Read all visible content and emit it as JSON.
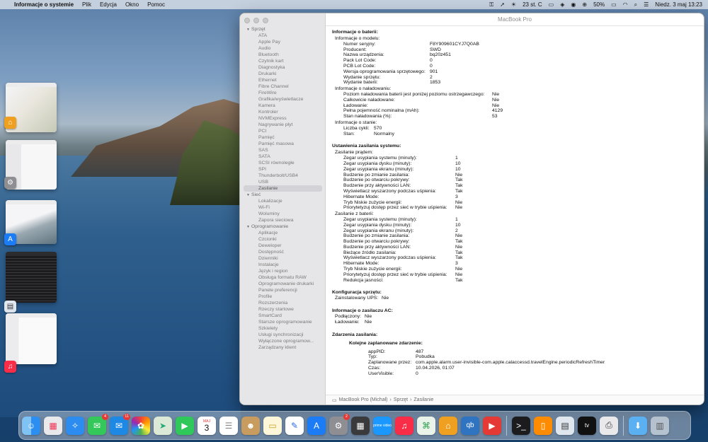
{
  "menubar": {
    "app_name": "Informacje o systemie",
    "menus": [
      "Plik",
      "Edycja",
      "Okno",
      "Pomoc"
    ],
    "weather": "23 st. C",
    "battery": "50%",
    "datetime": "Niedz. 3 maj  13:23"
  },
  "window": {
    "title": "MacBook Pro",
    "sidebar": [
      {
        "group": "Sprzęt",
        "items": [
          "ATA",
          "Apple Pay",
          "Audio",
          "Bluetooth",
          "Czytnik kart",
          "Diagnostyka",
          "Drukarki",
          "Ethernet",
          "Fibre Channel",
          "FireWire",
          "Grafika/wyświetlacze",
          "Kamera",
          "Kontroler",
          "NVMExpress",
          "Nagrywanie płyt",
          "PCI",
          "Pamięć",
          "Pamięć masowa",
          "SAS",
          "SATA",
          "SCSI równoległe",
          "SPI",
          "Thunderbolt/USB4",
          "USB",
          "Zasilanie"
        ]
      },
      {
        "group": "Sieć",
        "items": [
          "Lokalizacje",
          "Wi-Fi",
          "Woluminy",
          "Zapora sieciowa"
        ]
      },
      {
        "group": "Oprogramowanie",
        "items": [
          "Aplikacje",
          "Czcionki",
          "Deweloper",
          "Dostępność",
          "Dzienniki",
          "Instalacje",
          "Język i region",
          "Obsługa formatu RAW",
          "Oprogramowanie drukarki",
          "Panele preferencji",
          "Profile",
          "Rozszerzenia",
          "Rzeczy startowe",
          "SmartCard",
          "Starsze oprogramowanie",
          "Szkielety",
          "Usługi synchronizacji",
          "Wyłączone oprogramow...",
          "Zarządzany klient"
        ]
      }
    ],
    "selected_item": "Zasilanie",
    "detail": [
      {
        "type": "h",
        "text": "Informacje o baterii:"
      },
      {
        "type": "sub",
        "indent": 4,
        "text": "Informacje o modelu:"
      },
      {
        "type": "kv",
        "indent": 16,
        "kw": 122,
        "k": "Numer seryjny:",
        "v": "F8Y909601CYJ7Q0AB"
      },
      {
        "type": "kv",
        "indent": 16,
        "kw": 122,
        "k": "Producent:",
        "v": "SWD"
      },
      {
        "type": "kv",
        "indent": 16,
        "kw": 122,
        "k": "Nazwa urządzenia:",
        "v": "bq20z451"
      },
      {
        "type": "kv",
        "indent": 16,
        "kw": 122,
        "k": "Pack Lot Code:",
        "v": "0"
      },
      {
        "type": "kv",
        "indent": 16,
        "kw": 122,
        "k": "PCB Lot Code:",
        "v": "0"
      },
      {
        "type": "kv",
        "indent": 16,
        "kw": 122,
        "k": "Wersja oprogramowania sprzętowego:",
        "v": "901"
      },
      {
        "type": "kv",
        "indent": 16,
        "kw": 122,
        "k": "Wydanie sprzętu:",
        "v": "2"
      },
      {
        "type": "kv",
        "indent": 16,
        "kw": 122,
        "k": "Wydanie baterii:",
        "v": "1853"
      },
      {
        "type": "sub",
        "indent": 4,
        "text": "Informacje o naładowaniu:"
      },
      {
        "type": "kv",
        "indent": 16,
        "kw": 210,
        "k": "Poziom naładowania baterii jest poniżej poziomu ostrzegawczego:",
        "v": "Nie"
      },
      {
        "type": "kv",
        "indent": 16,
        "kw": 210,
        "k": "Całkowicie naładowane:",
        "v": "Nie"
      },
      {
        "type": "kv",
        "indent": 16,
        "kw": 210,
        "k": "Ładowanie:",
        "v": "Nie"
      },
      {
        "type": "kv",
        "indent": 16,
        "kw": 210,
        "k": "Pełna pojemność nominalna (mAh):",
        "v": "4129"
      },
      {
        "type": "kv",
        "indent": 16,
        "kw": 210,
        "k": "Stan naładowania (%):",
        "v": "53"
      },
      {
        "type": "sub",
        "indent": 4,
        "text": "Informacje o stanie:"
      },
      {
        "type": "kv",
        "indent": 16,
        "kw": 43,
        "k": "Liczba cykli:",
        "v": "570"
      },
      {
        "type": "kv",
        "indent": 16,
        "kw": 43,
        "k": "Stan:",
        "v": "Normalny"
      },
      {
        "type": "h",
        "text": "Ustawienia zasilania systemu:"
      },
      {
        "type": "sub",
        "indent": 4,
        "text": "Zasilanie prądem:"
      },
      {
        "type": "kv",
        "indent": 16,
        "kw": 158,
        "k": "Zegar usypiania systemu (minuty):",
        "v": "1"
      },
      {
        "type": "kv",
        "indent": 16,
        "kw": 158,
        "k": "Zegar usypiania dysku (minuty):",
        "v": "10"
      },
      {
        "type": "kv",
        "indent": 16,
        "kw": 158,
        "k": "Zegar usypiania ekranu (minuty):",
        "v": "10"
      },
      {
        "type": "kv",
        "indent": 16,
        "kw": 158,
        "k": "Budzenie po zmianie zasilania:",
        "v": "Nie"
      },
      {
        "type": "kv",
        "indent": 16,
        "kw": 158,
        "k": "Budzenie po otwarciu pokrywy:",
        "v": "Tak"
      },
      {
        "type": "kv",
        "indent": 16,
        "kw": 158,
        "k": "Budzenie przy aktywności LAN:",
        "v": "Tak"
      },
      {
        "type": "kv",
        "indent": 16,
        "kw": 158,
        "k": "Wyświetlacz wyszarzony podczas uśpienia:",
        "v": "Tak"
      },
      {
        "type": "kv",
        "indent": 16,
        "kw": 158,
        "k": "Hibernate Mode:",
        "v": "3"
      },
      {
        "type": "kv",
        "indent": 16,
        "kw": 158,
        "k": "Tryb Niskie zużycie energii:",
        "v": "Nie"
      },
      {
        "type": "kv",
        "indent": 16,
        "kw": 158,
        "k": "Priorytetyzuj dostęp przez sieć w trybie uśpienia:",
        "v": "Nie"
      },
      {
        "type": "sub",
        "indent": 4,
        "text": "Zasilanie z baterii:"
      },
      {
        "type": "kv",
        "indent": 16,
        "kw": 158,
        "k": "Zegar usypiania systemu (minuty):",
        "v": "1"
      },
      {
        "type": "kv",
        "indent": 16,
        "kw": 158,
        "k": "Zegar usypiania dysku (minuty):",
        "v": "10"
      },
      {
        "type": "kv",
        "indent": 16,
        "kw": 158,
        "k": "Zegar usypiania ekranu (minuty):",
        "v": "2"
      },
      {
        "type": "kv",
        "indent": 16,
        "kw": 158,
        "k": "Budzenie po zmianie zasilania:",
        "v": "Nie"
      },
      {
        "type": "kv",
        "indent": 16,
        "kw": 158,
        "k": "Budzenie po otwarciu pokrywy:",
        "v": "Tak"
      },
      {
        "type": "kv",
        "indent": 16,
        "kw": 158,
        "k": "Budzenie przy aktywności LAN:",
        "v": "Nie"
      },
      {
        "type": "kv",
        "indent": 16,
        "kw": 158,
        "k": "Bieżące źródło zasilania:",
        "v": "Tak"
      },
      {
        "type": "kv",
        "indent": 16,
        "kw": 158,
        "k": "Wyświetlacz wyszarzony podczas uśpienia:",
        "v": "Tak"
      },
      {
        "type": "kv",
        "indent": 16,
        "kw": 158,
        "k": "Hibernate Mode:",
        "v": "3"
      },
      {
        "type": "kv",
        "indent": 16,
        "kw": 158,
        "k": "Tryb Niskie zużycie energii:",
        "v": "Nie"
      },
      {
        "type": "kv",
        "indent": 16,
        "kw": 158,
        "k": "Priorytetyzuj dostęp przez sieć w trybie uśpienia:",
        "v": "Nie"
      },
      {
        "type": "kv",
        "indent": 16,
        "kw": 158,
        "k": "Redukcja jasności:",
        "v": "Tak"
      },
      {
        "type": "h",
        "text": "Konfiguracja sprzętu:"
      },
      {
        "type": "kv",
        "indent": 4,
        "kw": 66,
        "k": "Zainstalowany UPS:",
        "v": "Nie"
      },
      {
        "type": "h",
        "text": "Informacje o zasilaczu AC:"
      },
      {
        "type": "kv",
        "indent": 4,
        "kw": 42,
        "k": "Podłączony:",
        "v": "Nie"
      },
      {
        "type": "kv",
        "indent": 4,
        "kw": 42,
        "k": "Ładowanie:",
        "v": "Nie"
      },
      {
        "type": "h",
        "text": "Zdarzenia zasilania:"
      },
      {
        "type": "sub2",
        "indent": 24,
        "text": "Kolejne zaplanowane zdarzenie:"
      },
      {
        "type": "kv",
        "indent": 51,
        "kw": 67,
        "k": "appPID:",
        "v": "487"
      },
      {
        "type": "kv",
        "indent": 51,
        "kw": 67,
        "k": "Typ:",
        "v": "Pobudka"
      },
      {
        "type": "kv",
        "indent": 51,
        "kw": 67,
        "k": "Zaplanowane przez:",
        "v": "com.apple.alarm.user-invisible-com.apple.calaccessd.travelEngine.periodicRefreshTimer"
      },
      {
        "type": "kv",
        "indent": 51,
        "kw": 67,
        "k": "Czas:",
        "v": "10.04.2026, 01:07"
      },
      {
        "type": "kv",
        "indent": 51,
        "kw": 67,
        "k": "UserVisible:",
        "v": "0"
      }
    ],
    "statusbar": {
      "device": "MacBook Pro (Michał)",
      "path1": "Sprzęt",
      "path2": "Zasilanie",
      "sep": "›"
    }
  },
  "dock": {
    "messages_badge": "4",
    "mail_badge": "11",
    "calendar_month": "MAJ",
    "calendar_day": "3",
    "prime_label": "prime video",
    "tv_label": "tv",
    "qb_label": "qb",
    "settings_badge": "2"
  }
}
